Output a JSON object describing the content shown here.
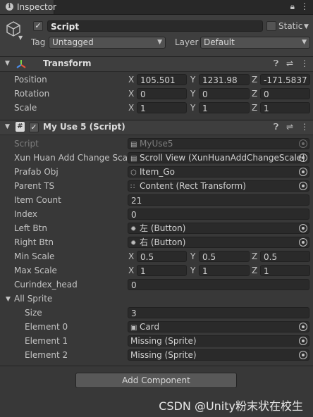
{
  "window": {
    "tab_label": "Inspector",
    "tab_icon": "info-icon",
    "lock_icon": "lock-icon",
    "menu_icon": "kebab-menu-icon"
  },
  "gameobject": {
    "active": true,
    "name": "Script",
    "static_label": "Static",
    "static_checked": false,
    "tag_label": "Tag",
    "tag_value": "Untagged",
    "layer_label": "Layer",
    "layer_value": "Default"
  },
  "transform": {
    "title": "Transform",
    "rows": [
      {
        "label": "Position",
        "x": "105.501",
        "y": "1231.98",
        "z": "-171.5837"
      },
      {
        "label": "Rotation",
        "x": "0",
        "y": "0",
        "z": "0"
      },
      {
        "label": "Scale",
        "x": "1",
        "y": "1",
        "z": "1"
      }
    ]
  },
  "script_component": {
    "title": "My Use 5 (Script)",
    "enabled": true,
    "script_label": "Script",
    "script_value": "MyUse5",
    "xunhuan_label": "Xun Huan Add Change Scale",
    "xunhuan_value": "Scroll View (XunHuanAddChangeScale)",
    "prefab_label": "Prafab Obj",
    "prefab_value": "Item_Go",
    "parent_label": "Parent TS",
    "parent_value": "Content (Rect Transform)",
    "item_count_label": "Item Count",
    "item_count_value": "21",
    "index_label": "Index",
    "index_value": "0",
    "left_btn_label": "Left Btn",
    "left_btn_value": "左 (Button)",
    "right_btn_label": "Right Btn",
    "right_btn_value": "右 (Button)",
    "min_scale": {
      "label": "Min Scale",
      "x": "0.5",
      "y": "0.5",
      "z": "0.5"
    },
    "max_scale": {
      "label": "Max Scale",
      "x": "1",
      "y": "1",
      "z": "1"
    },
    "curindex_label": "Curindex_head",
    "curindex_value": "0",
    "all_sprite_label": "All Sprite",
    "size_label": "Size",
    "size_value": "3",
    "elements": [
      {
        "label": "Element 0",
        "value": "Card"
      },
      {
        "label": "Element 1",
        "value": "Missing (Sprite)"
      },
      {
        "label": "Element 2",
        "value": "Missing (Sprite)"
      }
    ]
  },
  "axes": {
    "x": "X",
    "y": "Y",
    "z": "Z"
  },
  "add_component_label": "Add Component",
  "watermark": "CSDN @Unity粉末状在校生",
  "colors": {
    "background": "#383838",
    "header": "#3e3e3e",
    "field": "#2a2a2a",
    "text": "#c4c4c4"
  }
}
